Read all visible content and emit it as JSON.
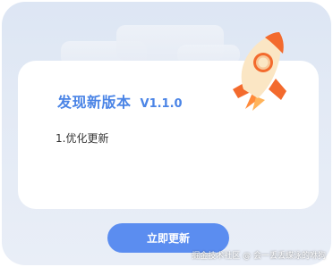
{
  "dialog": {
    "title": "发现新版本",
    "version": "V1.1.0",
    "notes": [
      "1.优化更新"
    ],
    "button_label": "立即更新"
  },
  "icons": {
    "illustration": "rocket-icon"
  },
  "watermark": "掘金技术社区 @ 会一丢丢蝶泳的咻狗",
  "colors": {
    "accent": "#4a84e6",
    "button": "#5b8df0",
    "rocket_body": "#fbe6c4",
    "rocket_flame": "#f36a2d"
  }
}
